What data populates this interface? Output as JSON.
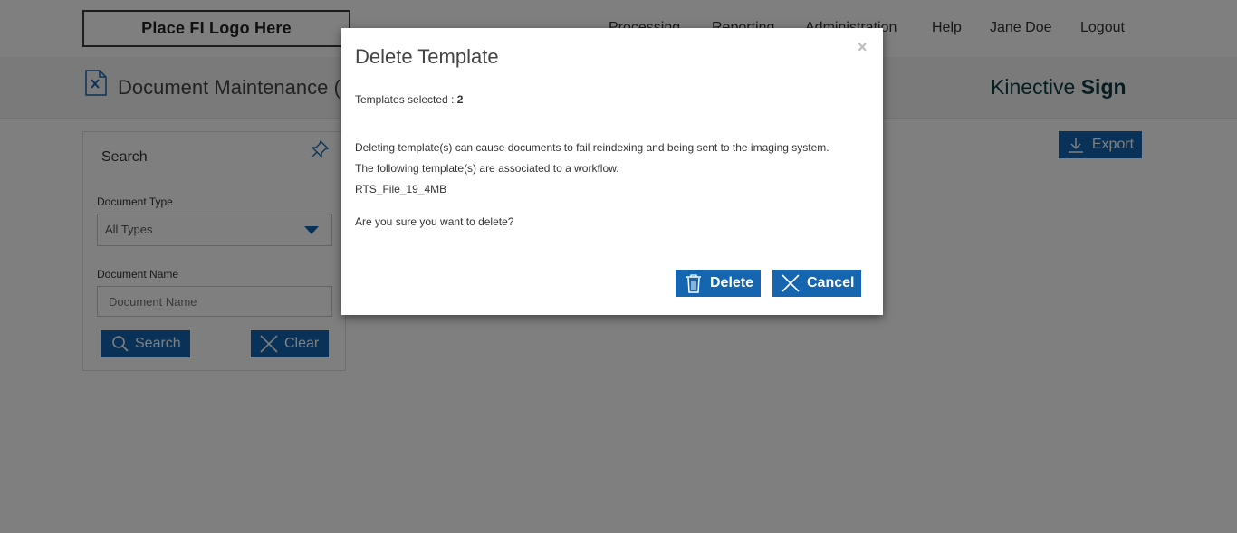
{
  "header": {
    "logo_text": "Place FI Logo Here",
    "nav": [
      "Processing",
      "Reporting",
      "Administration",
      "Help",
      "Jane Doe",
      "Logout"
    ]
  },
  "page": {
    "title": "Document Maintenance (",
    "brand_regular": "Kinective",
    "brand_bold": "Sign",
    "export_label": "Export"
  },
  "search": {
    "title": "Search",
    "doc_type_label": "Document Type",
    "doc_type_value": "All Types",
    "doc_name_label": "Document Name",
    "doc_name_placeholder": "Document Name",
    "search_label": "Search",
    "clear_label": "Clear"
  },
  "modal": {
    "title": "Delete Template",
    "close": "×",
    "selected_label": "Templates selected : ",
    "selected_count": "2",
    "warning": "Deleting template(s) can cause documents to fail reindexing and being sent to the imaging system.",
    "association": "The following template(s) are associated to a workflow.",
    "template_name": "RTS_File_19_4MB",
    "confirm": "Are you sure you want to delete?",
    "delete_label": "Delete",
    "cancel_label": "Cancel"
  },
  "colors": {
    "primary": "#1565b0",
    "overlay": "rgba(0,0,0,0.5)",
    "brand": "#0d3d45"
  }
}
